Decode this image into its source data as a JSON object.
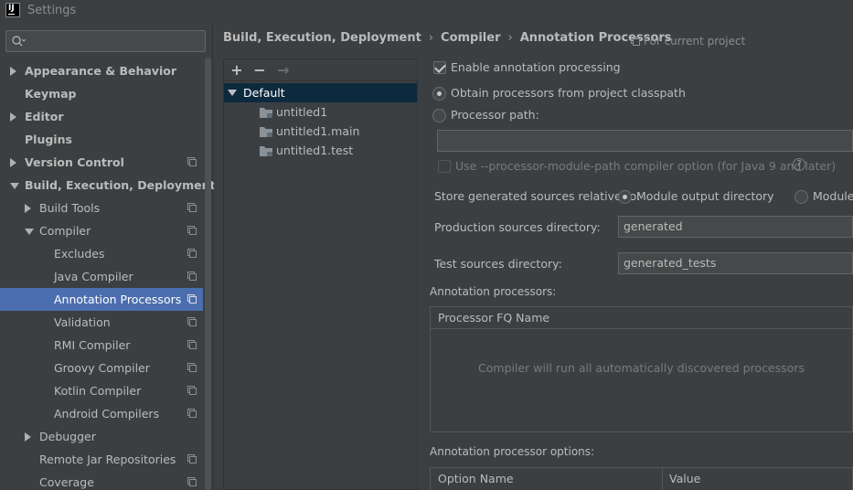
{
  "window": {
    "title": "Settings",
    "app_icon": "intellij-icon"
  },
  "search": {
    "placeholder": ""
  },
  "sidebar": {
    "items": [
      {
        "label": "Appearance & Behavior",
        "bold": true,
        "expander": "right",
        "indent": 0,
        "has_project_icon": false
      },
      {
        "label": "Keymap",
        "bold": true,
        "expander": "none",
        "indent": 0,
        "has_project_icon": false
      },
      {
        "label": "Editor",
        "bold": true,
        "expander": "right",
        "indent": 0,
        "has_project_icon": false
      },
      {
        "label": "Plugins",
        "bold": true,
        "expander": "none",
        "indent": 0,
        "has_project_icon": false
      },
      {
        "label": "Version Control",
        "bold": true,
        "expander": "right",
        "indent": 0,
        "has_project_icon": true
      },
      {
        "label": "Build, Execution, Deployment",
        "bold": true,
        "expander": "down",
        "indent": 0,
        "has_project_icon": false
      },
      {
        "label": "Build Tools",
        "bold": false,
        "expander": "right",
        "indent": 1,
        "has_project_icon": true
      },
      {
        "label": "Compiler",
        "bold": false,
        "expander": "down",
        "indent": 1,
        "has_project_icon": true
      },
      {
        "label": "Excludes",
        "bold": false,
        "expander": "none",
        "indent": 2,
        "has_project_icon": true
      },
      {
        "label": "Java Compiler",
        "bold": false,
        "expander": "none",
        "indent": 2,
        "has_project_icon": true
      },
      {
        "label": "Annotation Processors",
        "bold": false,
        "expander": "none",
        "indent": 2,
        "has_project_icon": true,
        "selected": true
      },
      {
        "label": "Validation",
        "bold": false,
        "expander": "none",
        "indent": 2,
        "has_project_icon": true
      },
      {
        "label": "RMI Compiler",
        "bold": false,
        "expander": "none",
        "indent": 2,
        "has_project_icon": true
      },
      {
        "label": "Groovy Compiler",
        "bold": false,
        "expander": "none",
        "indent": 2,
        "has_project_icon": true
      },
      {
        "label": "Kotlin Compiler",
        "bold": false,
        "expander": "none",
        "indent": 2,
        "has_project_icon": true
      },
      {
        "label": "Android Compilers",
        "bold": false,
        "expander": "none",
        "indent": 2,
        "has_project_icon": true
      },
      {
        "label": "Debugger",
        "bold": false,
        "expander": "right",
        "indent": 1,
        "has_project_icon": false
      },
      {
        "label": "Remote Jar Repositories",
        "bold": false,
        "expander": "none",
        "indent": 1,
        "has_project_icon": true
      },
      {
        "label": "Coverage",
        "bold": false,
        "expander": "none",
        "indent": 1,
        "has_project_icon": true
      }
    ]
  },
  "breadcrumb": {
    "items": [
      "Build, Execution, Deployment",
      "Compiler",
      "Annotation Processors"
    ],
    "separator": "›"
  },
  "scope": {
    "label": "For current project"
  },
  "profiles": {
    "toolbar": {
      "add": "+",
      "remove": "−",
      "move": "→"
    },
    "root": "Default",
    "children": [
      "untitled1",
      "untitled1.main",
      "untitled1.test"
    ]
  },
  "form": {
    "enable_processing": {
      "label": "Enable annotation processing",
      "checked": true
    },
    "obtain_classpath": {
      "label": "Obtain processors from project classpath",
      "checked": true
    },
    "processor_path": {
      "label": "Processor path:",
      "checked": false,
      "value": ""
    },
    "module_path_option": {
      "label": "Use --processor-module-path compiler option (for Java 9 and later)",
      "help": "?"
    },
    "store_relative": {
      "label": "Store generated sources relative to:",
      "option1": "Module output directory",
      "option2": "Module"
    },
    "production_dir": {
      "label": "Production sources directory:",
      "value": "generated"
    },
    "test_dir": {
      "label": "Test sources directory:",
      "value": "generated_tests"
    },
    "processors_section": "Annotation processors:",
    "processors_table": {
      "header": "Processor FQ Name",
      "empty_text": "Compiler will run all automatically discovered processors"
    },
    "options_section": "Annotation processor options:",
    "options_table": {
      "headers": [
        "Option Name",
        "Value"
      ]
    }
  },
  "colors": {
    "background": "#3c3f41",
    "selection": "#4b6eaf",
    "profile_selection": "#0d293e",
    "text": "#bbbbbb"
  }
}
